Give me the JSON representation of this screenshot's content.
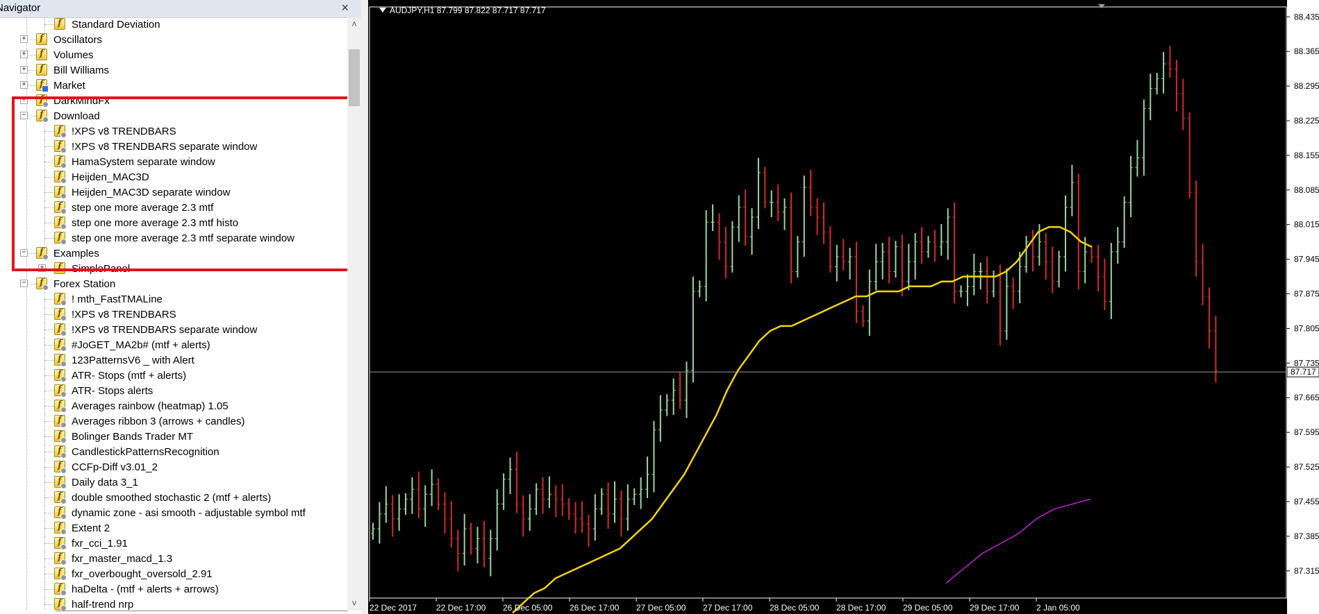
{
  "navigator": {
    "title": "Navigator",
    "close": "×",
    "scroll_up": "˄",
    "scroll_down": "˅",
    "items": [
      {
        "label": "Standard Deviation",
        "level": 2,
        "icon": "plain",
        "expander": ""
      },
      {
        "label": "Oscillators",
        "level": 1,
        "icon": "plain",
        "expander": "+"
      },
      {
        "label": "Volumes",
        "level": 1,
        "icon": "plain",
        "expander": "+"
      },
      {
        "label": "Bill Williams",
        "level": 1,
        "icon": "plain",
        "expander": "+"
      },
      {
        "label": "Market",
        "level": 1,
        "icon": "blue",
        "expander": "+"
      },
      {
        "label": "DarkMindFx",
        "level": 1,
        "icon": "gear",
        "expander": "+"
      },
      {
        "label": "Download",
        "level": 1,
        "icon": "gear",
        "expander": "−"
      },
      {
        "label": "!XPS v8 TRENDBARS",
        "level": 2,
        "icon": "gear",
        "expander": ""
      },
      {
        "label": "!XPS v8 TRENDBARS separate window",
        "level": 2,
        "icon": "gear",
        "expander": ""
      },
      {
        "label": "HamaSystem separate window",
        "level": 2,
        "icon": "gear",
        "expander": ""
      },
      {
        "label": "Heijden_MAC3D",
        "level": 2,
        "icon": "gear",
        "expander": ""
      },
      {
        "label": "Heijden_MAC3D separate window",
        "level": 2,
        "icon": "gear",
        "expander": ""
      },
      {
        "label": "step one more average 2.3 mtf",
        "level": 2,
        "icon": "gear",
        "expander": ""
      },
      {
        "label": "step one more average 2.3 mtf histo",
        "level": 2,
        "icon": "gear",
        "expander": ""
      },
      {
        "label": "step one more average 2.3 mtf separate window",
        "level": 2,
        "icon": "gear",
        "expander": ""
      },
      {
        "label": "Examples",
        "level": 1,
        "icon": "gear",
        "expander": "−"
      },
      {
        "label": "SimplePanel",
        "level": 2,
        "icon": "plain",
        "expander": "+"
      },
      {
        "label": "Forex Station",
        "level": 1,
        "icon": "gear",
        "expander": "−"
      },
      {
        "label": "!   mth_FastTMALine",
        "level": 2,
        "icon": "gear",
        "expander": ""
      },
      {
        "label": "!XPS v8 TRENDBARS",
        "level": 2,
        "icon": "gear",
        "expander": ""
      },
      {
        "label": "!XPS v8 TRENDBARS separate window",
        "level": 2,
        "icon": "gear",
        "expander": ""
      },
      {
        "label": "#JoGET_MA2b# (mtf + alerts)",
        "level": 2,
        "icon": "gear",
        "expander": ""
      },
      {
        "label": "123PatternsV6 _ with Alert",
        "level": 2,
        "icon": "gear",
        "expander": ""
      },
      {
        "label": "ATR- Stops (mtf + alerts)",
        "level": 2,
        "icon": "gear",
        "expander": ""
      },
      {
        "label": "ATR- Stops alerts",
        "level": 2,
        "icon": "gear",
        "expander": ""
      },
      {
        "label": "Averages rainbow (heatmap) 1.05",
        "level": 2,
        "icon": "gear",
        "expander": ""
      },
      {
        "label": "Averages ribbon 3 (arrows + candles)",
        "level": 2,
        "icon": "gear",
        "expander": ""
      },
      {
        "label": "Bolinger Bands Trader MT",
        "level": 2,
        "icon": "gear",
        "expander": ""
      },
      {
        "label": "CandlestickPatternsRecognition",
        "level": 2,
        "icon": "gear",
        "expander": ""
      },
      {
        "label": "CCFp-Diff v3.01_2",
        "level": 2,
        "icon": "gear",
        "expander": ""
      },
      {
        "label": "Daily data 3_1",
        "level": 2,
        "icon": "gear",
        "expander": ""
      },
      {
        "label": "double smoothed stochastic 2 (mtf + alerts)",
        "level": 2,
        "icon": "gear",
        "expander": ""
      },
      {
        "label": "dynamic zone - asi smooth - adjustable symbol mtf",
        "level": 2,
        "icon": "gear",
        "expander": ""
      },
      {
        "label": "Extent 2",
        "level": 2,
        "icon": "gear",
        "expander": ""
      },
      {
        "label": "fxr_cci_1.91",
        "level": 2,
        "icon": "gear",
        "expander": ""
      },
      {
        "label": "fxr_master_macd_1.3",
        "level": 2,
        "icon": "gear",
        "expander": ""
      },
      {
        "label": "fxr_overbought_oversold_2.91",
        "level": 2,
        "icon": "gear",
        "expander": ""
      },
      {
        "label": "haDelta - (mtf + alerts + arrows)",
        "level": 2,
        "icon": "gear",
        "expander": ""
      },
      {
        "label": "half-trend nrp",
        "level": 2,
        "icon": "gear",
        "expander": ""
      }
    ]
  },
  "chart": {
    "header": "AUDJPY,H1  87.799 87.822 87.717 87.717",
    "current_price_label": "87.717",
    "colors": {
      "background": "#000000",
      "bull": "#9fd4a0",
      "bear": "#d42a2a",
      "ma_fast": "#f5d50a",
      "ma_slow": "#c21fd2",
      "axis_text": "#000000"
    }
  },
  "chart_data": {
    "type": "candlestick",
    "symbol": "AUDJPY",
    "timeframe": "H1",
    "ohlc_header": [
      87.799,
      87.822,
      87.717,
      87.717
    ],
    "current_price": 87.717,
    "ylim": [
      87.26,
      88.455
    ],
    "y_ticks": [
      "88.435",
      "88.365",
      "88.295",
      "88.225",
      "88.155",
      "88.085",
      "88.015",
      "87.945",
      "87.875",
      "87.805",
      "87.735",
      "87.665",
      "87.595",
      "87.525",
      "87.455",
      "87.385",
      "87.315"
    ],
    "x_ticks": [
      "22 Dec 2017",
      "22 Dec 17:00",
      "26 Dec 05:00",
      "26 Dec 17:00",
      "27 Dec 05:00",
      "27 Dec 17:00",
      "28 Dec 05:00",
      "28 Dec 17:00",
      "29 Dec 05:00",
      "29 Dec 17:00",
      "2 Jan 05:00"
    ],
    "close": [
      87.4,
      87.43,
      87.45,
      87.42,
      87.44,
      87.46,
      87.48,
      87.44,
      87.47,
      87.49,
      87.45,
      87.42,
      87.38,
      87.35,
      87.4,
      87.36,
      87.38,
      87.34,
      87.38,
      87.45,
      87.5,
      87.52,
      87.45,
      87.42,
      87.44,
      87.48,
      87.46,
      87.47,
      87.46,
      87.45,
      87.43,
      87.42,
      87.41,
      87.4,
      87.44,
      87.47,
      87.43,
      87.46,
      87.42,
      87.46,
      87.47,
      87.48,
      87.51,
      87.6,
      87.64,
      87.66,
      87.68,
      87.66,
      87.72,
      87.88,
      87.89,
      88.02,
      88.02,
      87.98,
      87.93,
      88.01,
      88.05,
      87.99,
      88.03,
      88.12,
      88.06,
      88.06,
      88.04,
      88.05,
      87.92,
      87.98,
      88.09,
      88.05,
      88.03,
      88.0,
      87.93,
      87.95,
      87.94,
      87.95,
      87.84,
      87.82,
      87.9,
      87.94,
      87.96,
      87.92,
      87.97,
      87.9,
      87.94,
      87.98,
      87.96,
      87.98,
      87.97,
      87.98,
      88.03,
      87.88,
      87.88,
      87.89,
      87.92,
      87.92,
      87.88,
      87.91,
      87.8,
      87.89,
      87.88,
      87.93,
      87.98,
      87.95,
      87.98,
      87.94,
      87.9,
      87.95,
      88.05,
      88.1,
      87.92,
      87.96,
      87.95,
      87.91,
      87.86,
      87.96,
      87.98,
      88.06,
      88.13,
      88.15,
      88.25,
      88.29,
      88.31,
      88.34,
      88.33,
      88.28,
      88.23,
      88.08,
      87.94,
      87.87,
      87.8,
      87.72
    ],
    "series": [
      {
        "name": "",
        "color": "#f5d50a",
        "values": [
          87.23,
          87.25,
          87.27,
          87.28,
          87.3,
          87.31,
          87.32,
          87.33,
          87.34,
          87.35,
          87.36,
          87.38,
          87.4,
          87.42,
          87.45,
          87.48,
          87.51,
          87.55,
          87.59,
          87.63,
          87.68,
          87.72,
          87.75,
          87.78,
          87.8,
          87.81,
          87.81,
          87.82,
          87.83,
          87.84,
          87.85,
          87.86,
          87.87,
          87.87,
          87.88,
          87.88,
          87.88,
          87.89,
          87.89,
          87.89,
          87.9,
          87.9,
          87.91,
          87.91,
          87.91,
          87.91,
          87.92,
          87.94,
          87.97,
          88.0,
          88.01,
          88.01,
          88.0,
          87.98,
          87.97
        ]
      },
      {
        "name": "",
        "color": "#c21fd2",
        "values": [
          87.29,
          87.32,
          87.35,
          87.37,
          87.39,
          87.42,
          87.44,
          87.45,
          87.46
        ]
      }
    ],
    "grid": false
  }
}
